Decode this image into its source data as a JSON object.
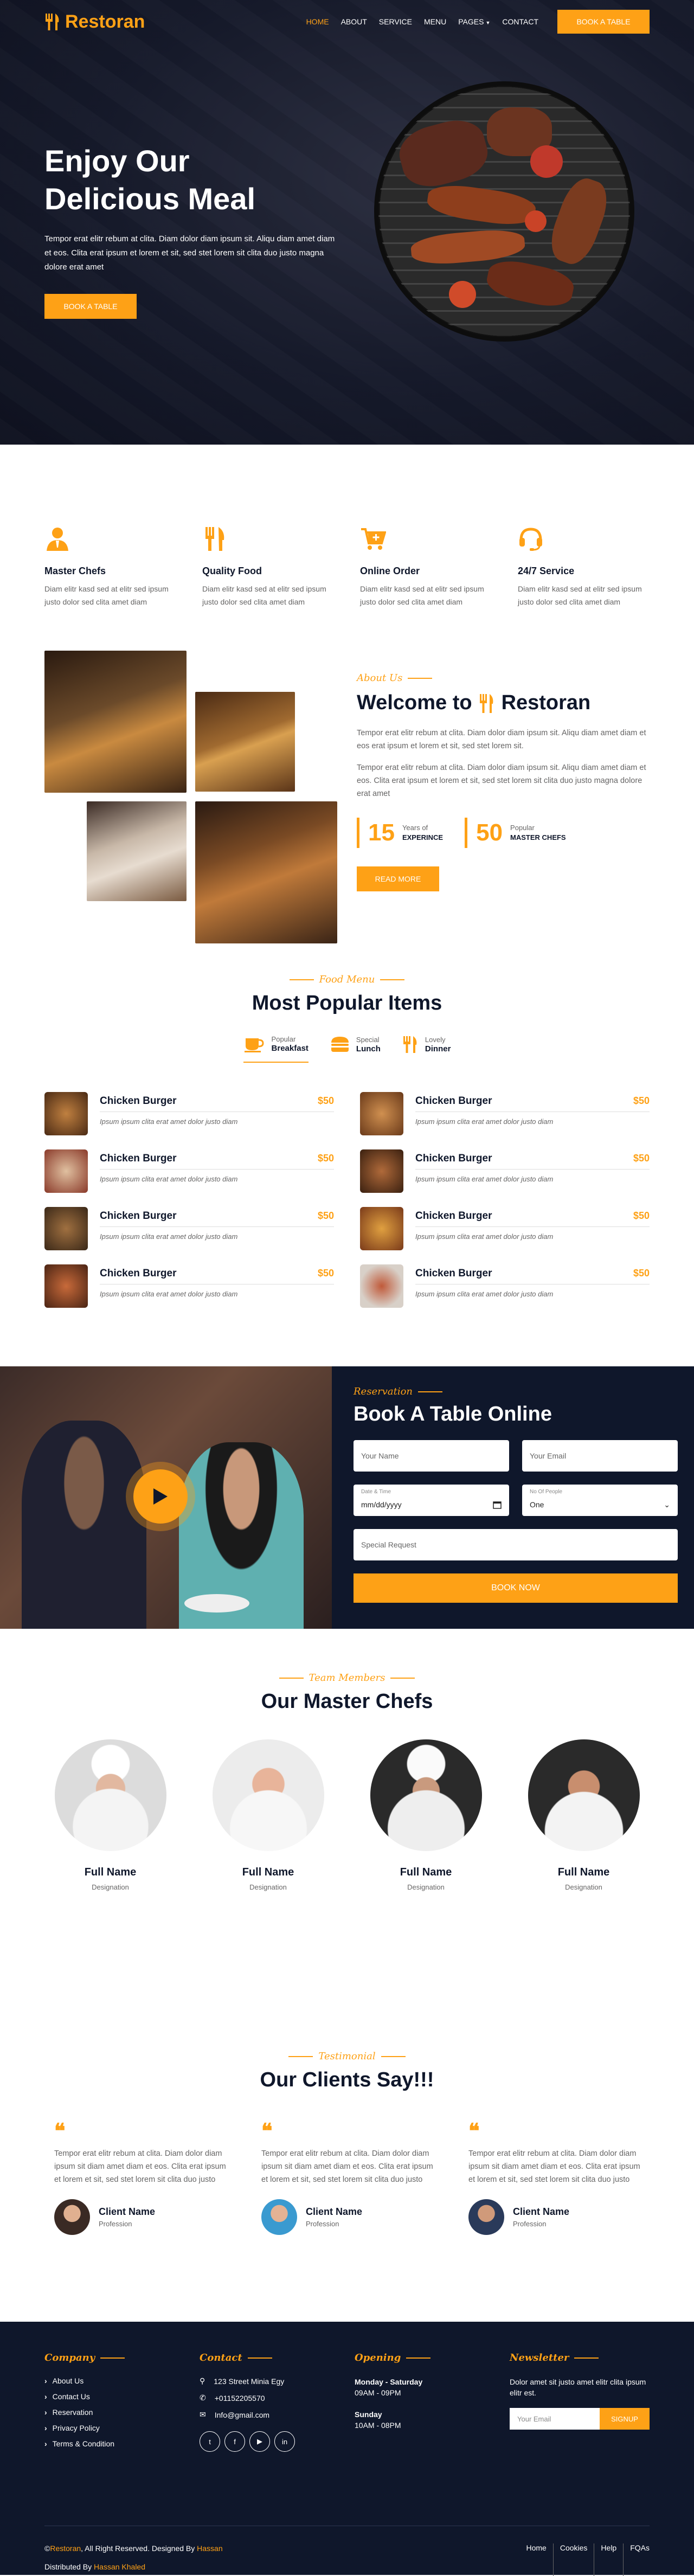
{
  "nav": {
    "brand": "Restoran",
    "links": [
      "HOME",
      "ABOUT",
      "SERVICE",
      "MENU",
      "PAGES",
      "CONTACT"
    ],
    "cta": "BOOK A TABLE"
  },
  "hero": {
    "title_line1": "Enjoy Our",
    "title_line2": "Delicious Meal",
    "text": "Tempor erat elitr rebum at clita. Diam dolor diam ipsum sit. Aliqu diam amet diam et eos. Clita erat ipsum et lorem et sit, sed stet lorem sit clita duo justo magna dolore erat amet",
    "button": "BOOK A TABLE"
  },
  "services": [
    {
      "icon": "user-tie-icon",
      "title": "Master Chefs",
      "text": "Diam elitr kasd sed at elitr sed ipsum justo dolor sed clita amet diam"
    },
    {
      "icon": "utensils-icon",
      "title": "Quality Food",
      "text": "Diam elitr kasd sed at elitr sed ipsum justo dolor sed clita amet diam"
    },
    {
      "icon": "cart-plus-icon",
      "title": "Online Order",
      "text": "Diam elitr kasd sed at elitr sed ipsum justo dolor sed clita amet diam"
    },
    {
      "icon": "headset-icon",
      "title": "24/7 Service",
      "text": "Diam elitr kasd sed at elitr sed ipsum justo dolor sed clita amet diam"
    }
  ],
  "about": {
    "eyebrow": "About Us",
    "title_prefix": "Welcome to",
    "title_brand": "Restoran",
    "p1": "Tempor erat elitr rebum at clita. Diam dolor diam ipsum sit. Aliqu diam amet diam et eos erat ipsum et lorem et sit, sed stet lorem sit.",
    "p2": "Tempor erat elitr rebum at clita. Diam dolor diam ipsum sit. Aliqu diam amet diam et eos. Clita erat ipsum et lorem et sit, sed stet lorem sit clita duo justo magna dolore erat amet",
    "stat1_num": "15",
    "stat1_small": "Years of",
    "stat1_big": "EXPERINCE",
    "stat2_num": "50",
    "stat2_small": "Popular",
    "stat2_big": "MASTER CHEFS",
    "button": "READ MORE"
  },
  "menu": {
    "eyebrow": "Food Menu",
    "title": "Most Popular Items",
    "tabs": [
      {
        "icon": "coffee-icon",
        "small": "Popular",
        "big": "Breakfast"
      },
      {
        "icon": "hamburger-icon",
        "small": "Special",
        "big": "Lunch"
      },
      {
        "icon": "utensils-icon",
        "small": "Lovely",
        "big": "Dinner"
      }
    ],
    "item_name": "Chicken Burger",
    "item_price": "$50",
    "item_desc": "Ipsum ipsum clita erat amet dolor justo diam"
  },
  "reservation": {
    "eyebrow": "Reservation",
    "title": "Book A Table Online",
    "name_placeholder": "Your Name",
    "email_placeholder": "Your Email",
    "date_label": "Date & Time",
    "date_value": "mm/dd/yyyy",
    "people_label": "No Of People",
    "people_value": "One",
    "request_placeholder": "Special Request",
    "button": "BOOK NOW"
  },
  "team": {
    "eyebrow": "Team Members",
    "title": "Our Master Chefs",
    "member_name": "Full Name",
    "member_role": "Designation"
  },
  "testimonial": {
    "eyebrow": "Testimonial",
    "title": "Our Clients Say!!!",
    "text": "Tempor erat elitr rebum at clita. Diam dolor diam ipsum sit diam amet diam et eos. Clita erat ipsum et lorem et sit, sed stet lorem sit clita duo justo",
    "client_name": "Client Name",
    "client_role": "Profession"
  },
  "footer": {
    "company_title": "Company",
    "company_links": [
      "About Us",
      "Contact Us",
      "Reservation",
      "Privacy Policy",
      "Terms & Condition"
    ],
    "contact_title": "Contact",
    "address": "123 Street Minia Egy",
    "phone": "+01152205570",
    "email": "Info@gmail.com",
    "opening_title": "Opening",
    "days1": "Monday - Saturday",
    "hours1": "09AM - 09PM",
    "days2": "Sunday",
    "hours2": "10AM - 08PM",
    "news_title": "Newsletter",
    "news_text": "Dolor amet sit justo amet elitr clita ipsum elitr est.",
    "news_placeholder": "Your Email",
    "news_button": "SIGNUP",
    "copy_prefix": "©",
    "copy_brand": "Restoran",
    "copy_mid": ", All Right Reserved. Designed By ",
    "copy_designer": "Hassan",
    "dist_prefix": "Distributed By ",
    "dist_name": "Hassan Khaled",
    "bottom_links": [
      "Home",
      "Cookies",
      "Help",
      "FQAs"
    ]
  },
  "colors": {
    "primary": "#FEA116",
    "dark": "#0F172B"
  }
}
